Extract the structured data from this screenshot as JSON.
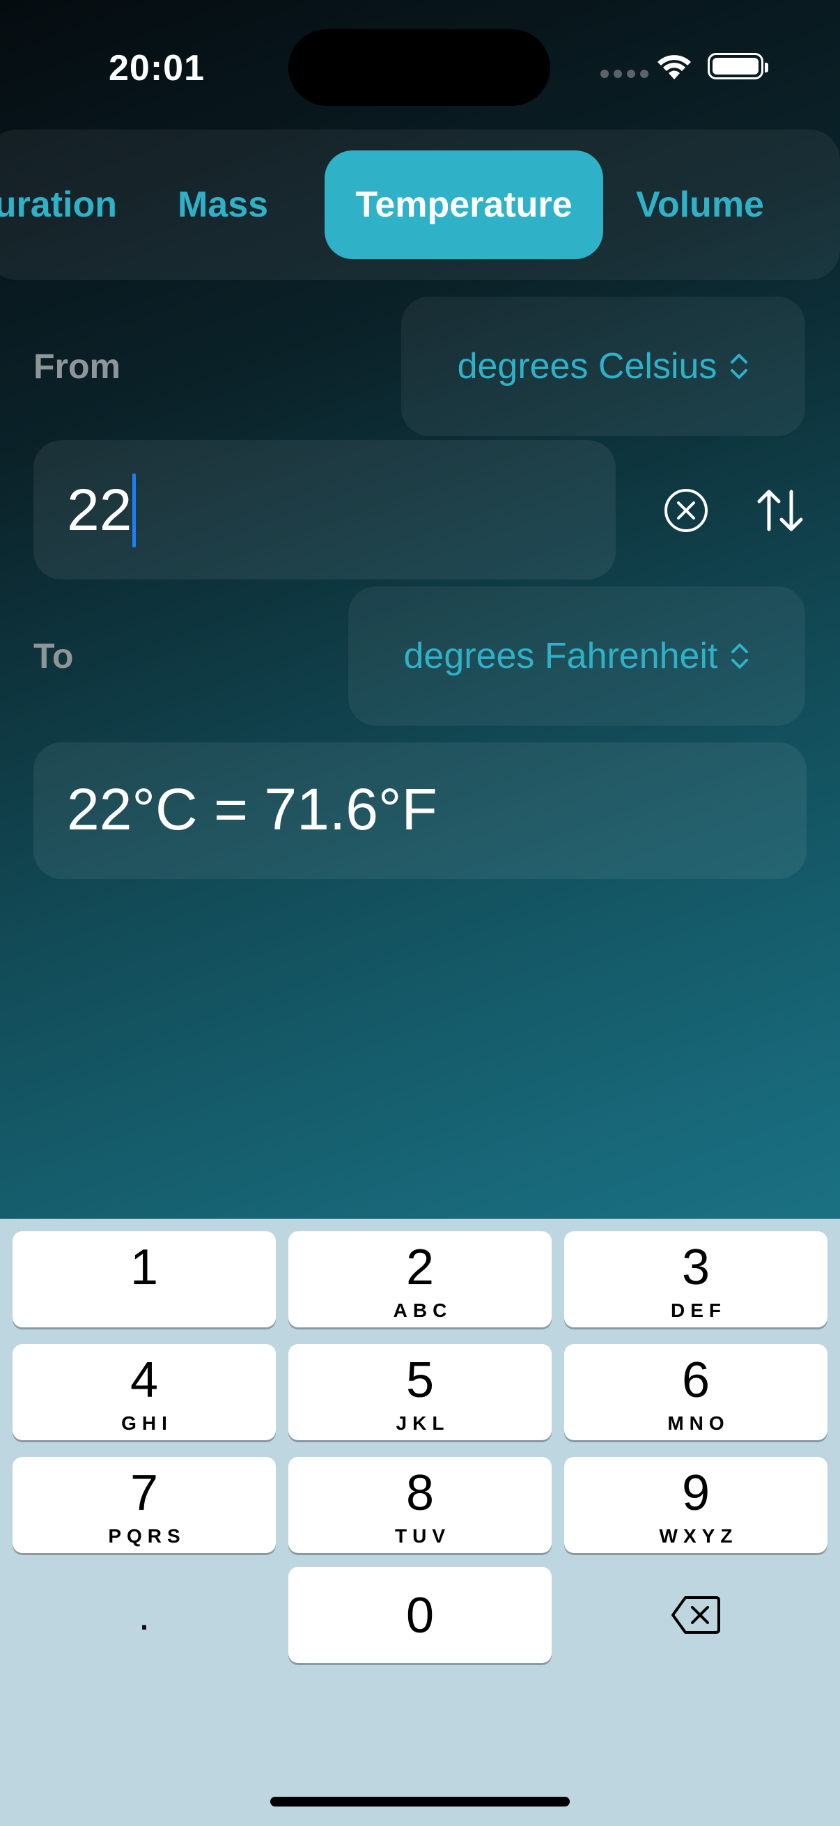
{
  "status_bar": {
    "time": "20:01"
  },
  "tabs": [
    {
      "label": "Duration"
    },
    {
      "label": "Mass"
    },
    {
      "label": "Temperature",
      "selected": true
    },
    {
      "label": "Volume"
    }
  ],
  "tab_visible_labels": {
    "duration": "uration"
  },
  "from": {
    "label": "From",
    "unit": "degrees Celsius"
  },
  "input": {
    "value": "22"
  },
  "to": {
    "label": "To",
    "unit": "degrees Fahrenheit"
  },
  "result": {
    "text": "22°C = 71.6°F"
  },
  "keyboard": {
    "keys": [
      {
        "num": "1",
        "letters": ""
      },
      {
        "num": "2",
        "letters": "ABC"
      },
      {
        "num": "3",
        "letters": "DEF"
      },
      {
        "num": "4",
        "letters": "GHI"
      },
      {
        "num": "5",
        "letters": "JKL"
      },
      {
        "num": "6",
        "letters": "MNO"
      },
      {
        "num": "7",
        "letters": "PQRS"
      },
      {
        "num": "8",
        "letters": "TUV"
      },
      {
        "num": "9",
        "letters": "WXYZ"
      },
      {
        "num": "0",
        "letters": ""
      }
    ],
    "decimal": "."
  },
  "colors": {
    "accent": "#2fb1c8",
    "keyboard_bg": "#bed6df",
    "caret": "#1f7ff2"
  },
  "icons": {
    "clear": "clear-circle-icon",
    "swap": "swap-arrows-icon",
    "delete": "delete-backward-icon",
    "picker": "chevron-updown-icon"
  }
}
